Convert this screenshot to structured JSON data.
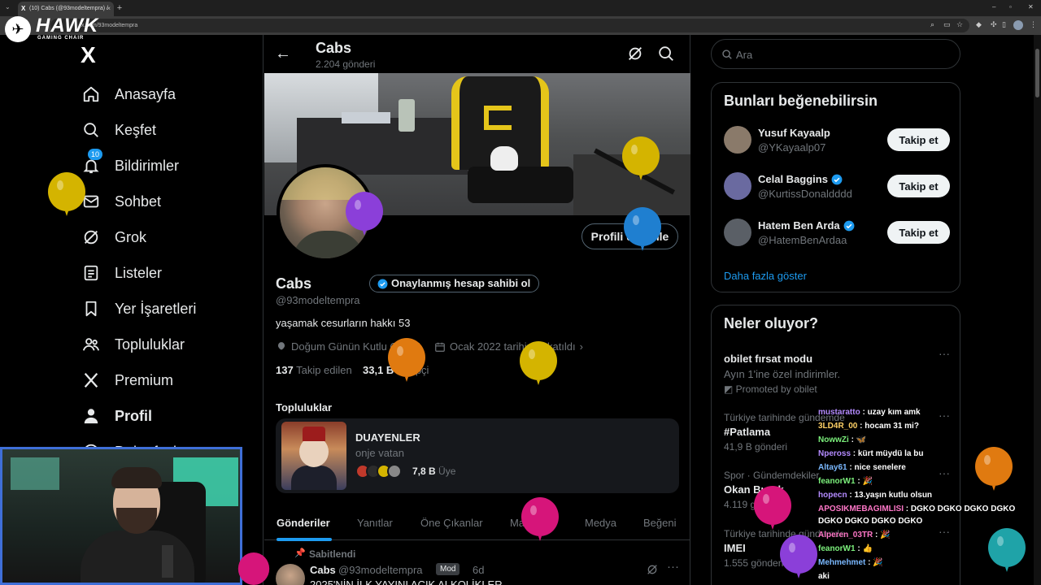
{
  "browser": {
    "tab_title": "(10) Cabs (@93modeltempra) /",
    "url": "x.com/93modeltempra",
    "new_tab": "+",
    "tab_close": "×",
    "minimize": "–",
    "restore": "▫",
    "close": "✕"
  },
  "overlay_logo": {
    "text": "HAWK",
    "sub": "GAMING CHAIR"
  },
  "nav": {
    "logo": "X",
    "notif_badge": "10",
    "items": [
      {
        "label": "Anasayfa",
        "icon": "home-icon"
      },
      {
        "label": "Keşfet",
        "icon": "search-icon"
      },
      {
        "label": "Bildirimler",
        "icon": "bell-icon"
      },
      {
        "label": "Sohbet",
        "icon": "mail-icon"
      },
      {
        "label": "Grok",
        "icon": "grok-icon"
      },
      {
        "label": "Listeler",
        "icon": "list-icon"
      },
      {
        "label": "Yer İşaretleri",
        "icon": "bookmark-icon"
      },
      {
        "label": "Topluluklar",
        "icon": "communities-icon"
      },
      {
        "label": "Premium",
        "icon": "x-icon"
      },
      {
        "label": "Profil",
        "icon": "person-icon"
      },
      {
        "label": "Daha fazla",
        "icon": "more-icon"
      }
    ]
  },
  "profile": {
    "header_name": "Cabs",
    "post_count": "2.204 gönderi",
    "name": "Cabs",
    "verify_pill": "Onaylanmış hesap sahibi ol",
    "handle": "@93modeltempra",
    "bio": "yaşamak cesurların hakkı 53",
    "birthday": "Doğum Günün Kutlu Olsun!",
    "joined": "Ocak 2022 tarihinde katıldı",
    "following_count": "137",
    "following_label": "Takip edilen",
    "followers_count": "33,1 B",
    "followers_label": "Takipçi",
    "edit_button": "Profili düzenle"
  },
  "communities": {
    "heading": "Topluluklar",
    "card": {
      "name": "DUAYENLER",
      "subtitle": "onje vatan",
      "members": "7,8 B",
      "members_label": "Üye"
    }
  },
  "tabs": [
    "Gönderiler",
    "Yanıtlar",
    "Öne Çıkanlar",
    "Makaleler",
    "Medya",
    "Beğeni"
  ],
  "pinned_post": {
    "pinned_label": "Sabitlendi",
    "author": "Cabs",
    "handle": "@93modeltempra",
    "badge": "Mod",
    "time": "6d",
    "text": "2025'NİN İLK YAYINI AÇIK ALKOLİKLER"
  },
  "search": {
    "placeholder": "Ara"
  },
  "who_to_follow": {
    "title": "Bunları beğenebilirsin",
    "follow_label": "Takip et",
    "users": [
      {
        "name": "Yusuf Kayaalp",
        "handle": "@YKayaalp07",
        "verified": false,
        "avatar_color": "#8a7a6a"
      },
      {
        "name": "Celal Baggins",
        "handle": "@KurtissDonaldddd",
        "verified": true,
        "avatar_color": "#6a6aa0"
      },
      {
        "name": "Hatem Ben Arda",
        "handle": "@HatemBenArdaa",
        "verified": true,
        "avatar_color": "#5a5f66"
      }
    ],
    "show_more": "Daha fazla göster"
  },
  "trends": {
    "title": "Neler oluyor?",
    "items": [
      {
        "meta": "",
        "title": "obilet fırsat modu",
        "count": "Ayın 1'ine özel indirimler.",
        "promoted": "Promoted by obilet"
      },
      {
        "meta": "Türkiye tarihinde gündemde",
        "title": "#Patlama",
        "count": "41,9 B gönderi"
      },
      {
        "meta": "Spor · Gündemdekiler",
        "title": "Okan Buruk",
        "count": "4.119 gönderi"
      },
      {
        "meta": "Türkiye tarihinde gündemde",
        "title": "IMEI",
        "count": "1.555 gönderi"
      }
    ]
  },
  "chat": [
    {
      "user": "mustaratto",
      "color": "#b48bff",
      "msg": ": uzay kım amk"
    },
    {
      "user": "3LD4R_00",
      "color": "#ffd166",
      "msg": ": hocam 31 mi?"
    },
    {
      "user": "NowwZi",
      "color": "#7cf07c",
      "msg": ": 🦋"
    },
    {
      "user": "Npeross",
      "color": "#b48bff",
      "msg": ": kürt müydü la bu"
    },
    {
      "user": "Altay61",
      "color": "#7ab8ff",
      "msg": ": nice senelere"
    },
    {
      "user": "feanorW1",
      "color": "#7cf07c",
      "msg": ": 🎉"
    },
    {
      "user": "hopecn",
      "color": "#b48bff",
      "msg": ": 13.yaşın kutlu olsun"
    },
    {
      "user": "APOSIKMEBAGIMLISI",
      "color": "#ff77c8",
      "msg": ": DGKO DGKO DGKO DGKO"
    },
    {
      "user": "",
      "color": "#ffffff",
      "msg": "DGKO DGKO DGKO DGKO"
    },
    {
      "user": "Alperen_03TR",
      "color": "#ff77c8",
      "msg": ": 🎉"
    },
    {
      "user": "feanorW1",
      "color": "#7cf07c",
      "msg": ": 👍"
    },
    {
      "user": "Mehmehmet",
      "color": "#7ab8ff",
      "msg": ": 🎉"
    },
    {
      "user": "",
      "color": "#ffffff",
      "msg": "aki"
    }
  ],
  "colors": {
    "accent": "#1d9bf0",
    "balloon_yellow": "#d4b400",
    "balloon_purple": "#8b3fd9",
    "balloon_blue": "#1f7fd0",
    "balloon_orange": "#e07a10",
    "balloon_pink": "#d6157a",
    "balloon_teal": "#1fa3a8"
  }
}
